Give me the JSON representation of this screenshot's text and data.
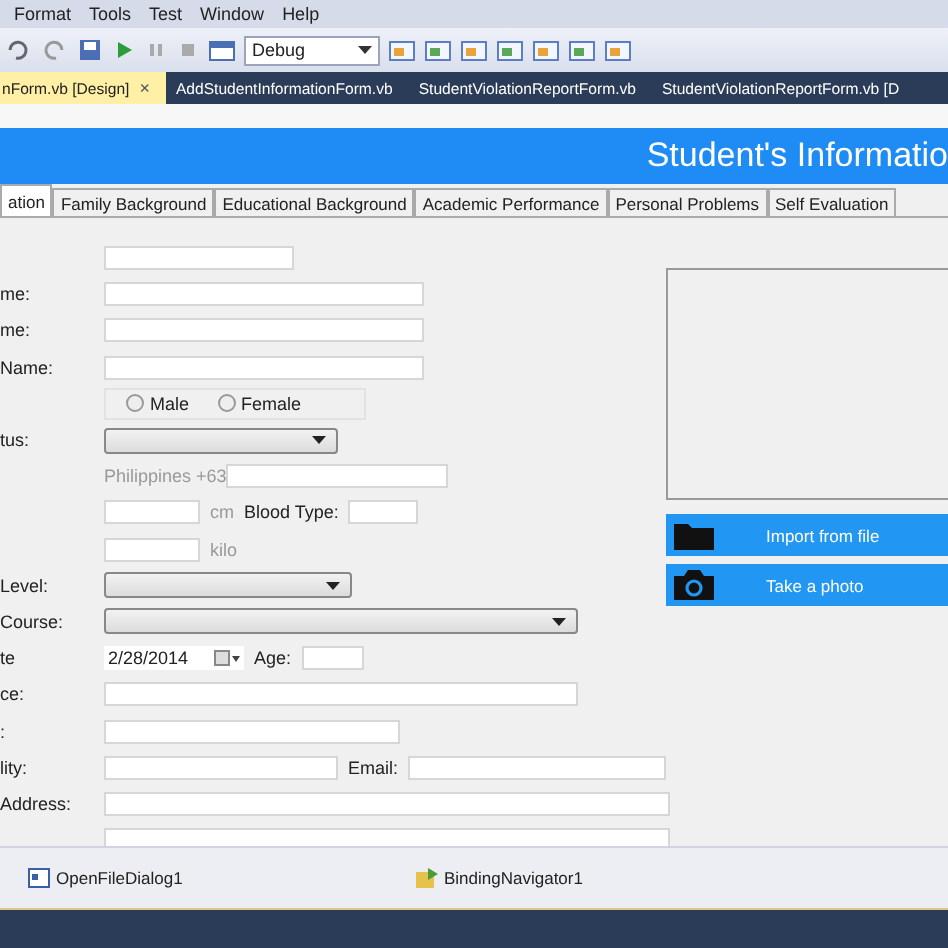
{
  "menu": [
    "Format",
    "Tools",
    "Test",
    "Window",
    "Help"
  ],
  "toolbar": {
    "config": "Debug"
  },
  "doc_tabs": [
    {
      "label": "nForm.vb [Design]",
      "selected": true,
      "close": "×"
    },
    {
      "label": "AddStudentInformationForm.vb",
      "selected": false
    },
    {
      "label": "StudentViolationReportForm.vb",
      "selected": false
    },
    {
      "label": "StudentViolationReportForm.vb [D",
      "selected": false
    }
  ],
  "header": {
    "title": "Student's Informatio"
  },
  "form_tabs": [
    {
      "label": "ation",
      "selected": true
    },
    {
      "label": "Family Background",
      "selected": false
    },
    {
      "label": "Educational Background",
      "selected": false
    },
    {
      "label": "Academic Performance",
      "selected": false
    },
    {
      "label": "Personal Problems",
      "selected": false
    },
    {
      "label": "Self Evaluation",
      "selected": false
    }
  ],
  "rows": [
    {
      "kind": "text"
    },
    {
      "kind": "text",
      "label": "me:"
    },
    {
      "kind": "text",
      "label": "me:"
    },
    {
      "kind": "text",
      "label": "Name:"
    },
    {
      "kind": "radio",
      "options": [
        {
          "label": "Male",
          "selected": false
        },
        {
          "label": "Female",
          "selected": false
        }
      ]
    },
    {
      "kind": "select",
      "label": "tus:"
    },
    {
      "kind": "phone",
      "prefix": "Philippines +63"
    },
    {
      "kind": "pair",
      "unit": "cm",
      "label2": "Blood Type:"
    },
    {
      "kind": "unit",
      "unit": "kilo"
    },
    {
      "kind": "select",
      "label": "Level:"
    },
    {
      "kind": "select",
      "label": "Course:"
    },
    {
      "kind": "date",
      "label": "te",
      "value": "2/28/2014",
      "label2": "Age:"
    },
    {
      "kind": "text",
      "label": "ce:"
    },
    {
      "kind": "text",
      "label": ":"
    },
    {
      "kind": "pair",
      "label": "lity:",
      "label2": "Email:"
    },
    {
      "kind": "text",
      "label": "Address:"
    },
    {
      "kind": "text"
    }
  ],
  "photo_buttons": [
    {
      "kind": "folder",
      "label": "Import from file"
    },
    {
      "kind": "camera",
      "label": "Take a photo"
    }
  ],
  "tray": [
    {
      "kind": "dialog",
      "label": "OpenFileDialog1"
    },
    {
      "kind": "navigator",
      "label": "BindingNavigator1"
    }
  ]
}
